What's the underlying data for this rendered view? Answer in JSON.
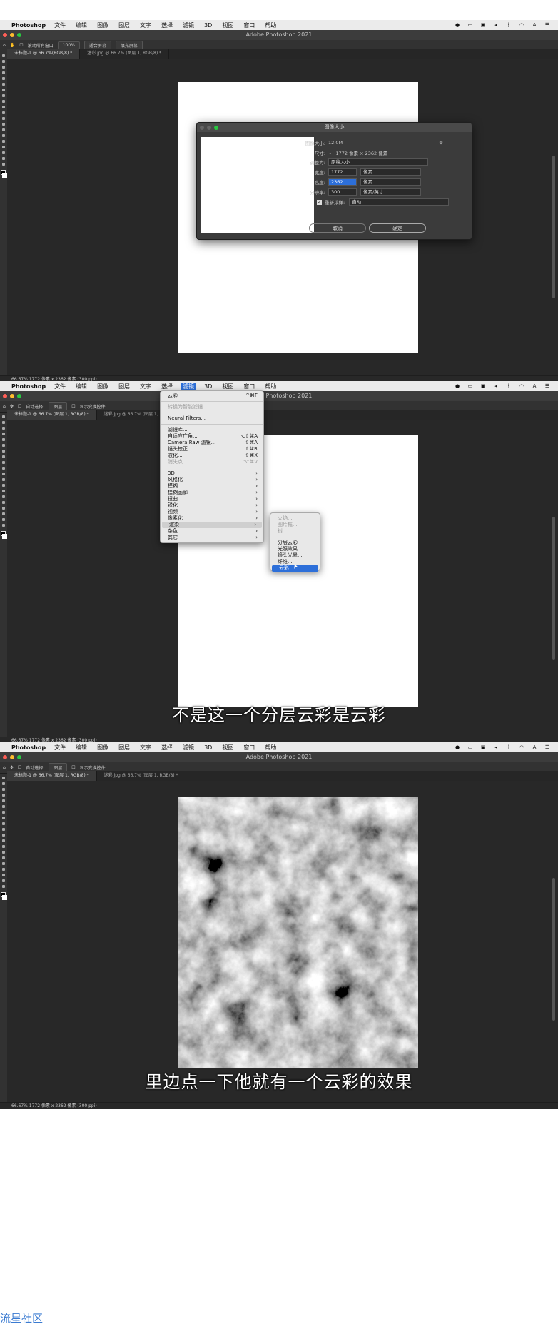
{
  "app": {
    "apple_symbol": "",
    "name": "Photoshop",
    "window_title": "Adobe Photoshop 2021"
  },
  "menus": [
    "文件",
    "编辑",
    "图像",
    "图层",
    "文字",
    "选择",
    "滤镜",
    "3D",
    "视图",
    "窗口",
    "帮助"
  ],
  "panel1": {
    "options": {
      "scroll_all": "滚动所有窗口",
      "zoom": "100%",
      "fit": "适合屏幕",
      "fill": "填充屏幕"
    },
    "tabs": [
      "未标题-1 @ 66.7%(RGB/8) *",
      "迷彩.jpg @ 66.7% (图层 1, RGB/8) *"
    ],
    "status": "66.67%   1772 像素 x 2362 像素 (300 ppi)",
    "dialog": {
      "title": "图像大小",
      "size_label": "图像大小:",
      "size_value": "12.0M",
      "dims_label": "尺寸:",
      "dims_value": "1772 像素 × 2362 像素",
      "fit_label": "调整为:",
      "fit_value": "原稿大小",
      "width_label": "宽度:",
      "width_value": "1772",
      "width_unit": "像素",
      "height_label": "高度:",
      "height_value": "2362",
      "height_unit": "像素",
      "res_label": "分辨率:",
      "res_value": "300",
      "res_unit": "像素/英寸",
      "resample_label": "重新采样:",
      "resample_value": "自动",
      "cancel": "取消",
      "ok": "确定"
    }
  },
  "panel2": {
    "options": {
      "auto_select": "自动选择:",
      "layer": "图层",
      "show_transform": "显示变换控件"
    },
    "tabs": [
      "未标题-1 @ 66.7% (图层 1, RGB/8) *",
      "迷彩.jpg @ 66.7% (图层 1, RGB/8) *"
    ],
    "status": "66.67%   1772 像素 x 2362 像素 (300 ppi)",
    "filter_menu": [
      {
        "label": "云彩",
        "shortcut": "^⌘F"
      },
      {
        "sep": true
      },
      {
        "label": "转换为智能滤镜",
        "dis": true
      },
      {
        "sep": true
      },
      {
        "label": "Neural Filters..."
      },
      {
        "sep": true
      },
      {
        "label": "滤镜库..."
      },
      {
        "label": "自适应广角...",
        "shortcut": "⌥⇧⌘A"
      },
      {
        "label": "Camera Raw 滤镜...",
        "shortcut": "⇧⌘A"
      },
      {
        "label": "镜头校正...",
        "shortcut": "⇧⌘R"
      },
      {
        "label": "液化...",
        "shortcut": "⇧⌘X"
      },
      {
        "label": "消失点...",
        "shortcut": "⌥⌘V",
        "dis": true
      },
      {
        "sep": true
      },
      {
        "label": "3D",
        "shortcut": "›"
      },
      {
        "label": "风格化",
        "shortcut": "›"
      },
      {
        "label": "模糊",
        "shortcut": "›"
      },
      {
        "label": "模糊画廊",
        "shortcut": "›"
      },
      {
        "label": "扭曲",
        "shortcut": "›"
      },
      {
        "label": "锐化",
        "shortcut": "›"
      },
      {
        "label": "视频",
        "shortcut": "›"
      },
      {
        "label": "像素化",
        "shortcut": "›"
      },
      {
        "label": "渲染",
        "shortcut": "›",
        "active": true
      },
      {
        "label": "杂色",
        "shortcut": "›"
      },
      {
        "label": "其它",
        "shortcut": "›"
      }
    ],
    "render_submenu": [
      {
        "label": "火焰...",
        "dis": true
      },
      {
        "label": "图片框...",
        "dis": true
      },
      {
        "label": "树...",
        "dis": true
      },
      {
        "sep": true
      },
      {
        "label": "分层云彩"
      },
      {
        "label": "光照效果..."
      },
      {
        "label": "镜头光晕..."
      },
      {
        "label": "纤维..."
      },
      {
        "label": "云彩",
        "hl": true
      }
    ],
    "subtitle": "不是这一个分层云彩是云彩"
  },
  "panel3": {
    "options": {
      "auto_select": "自动选择:",
      "layer": "图层",
      "show_transform": "显示变换控件"
    },
    "tabs": [
      "未标题-1 @ 66.7% (图层 1, RGB/8) *",
      "迷彩.jpg @ 66.7% (图层 1, RGB/8) *"
    ],
    "status": "66.67%   1772 像素 x 2362 像素 (300 ppi)",
    "subtitle": "里边点一下他就有一个云彩的效果"
  },
  "watermark": "流星社区"
}
